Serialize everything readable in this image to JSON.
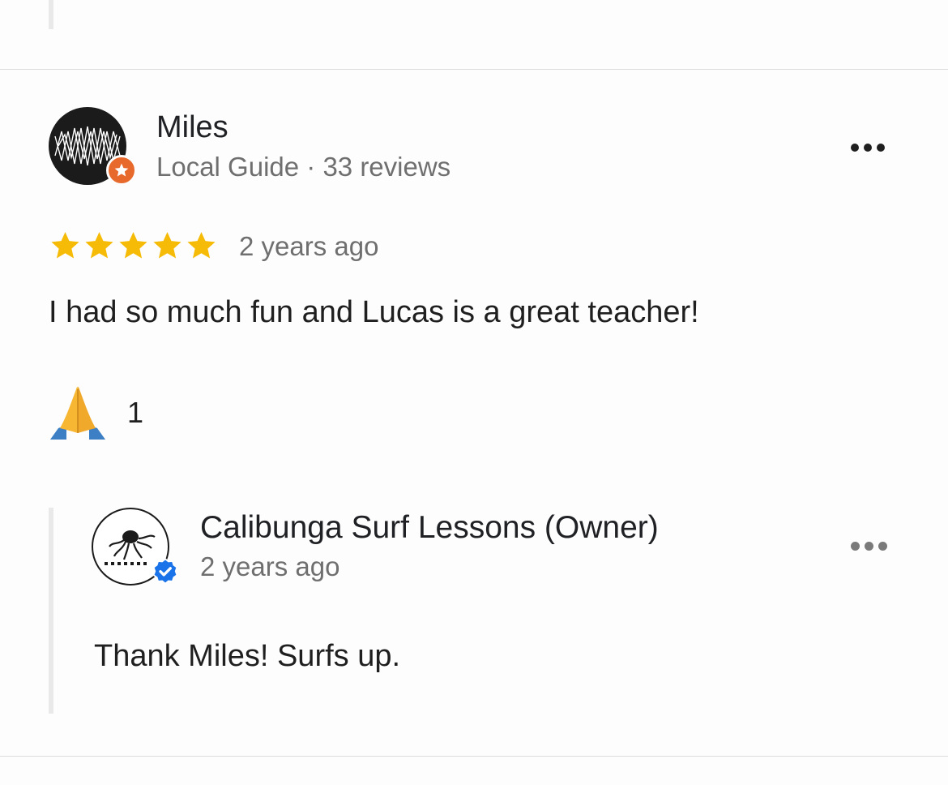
{
  "review": {
    "reviewer_name": "Miles",
    "reviewer_meta": "Local Guide · 33 reviews",
    "rating": 5,
    "rating_max": 5,
    "time": "2 years ago",
    "text": "I had so much fun and Lucas is a great teacher!",
    "reaction_emoji": "🙏",
    "reaction_count": "1"
  },
  "owner_reply": {
    "name": "Calibunga Surf Lessons (Owner)",
    "time": "2 years ago",
    "text": "Thank Miles! Surfs up.",
    "logo_text": "CALIBUNGA"
  },
  "icons": {
    "more": "more-horizontal-icon",
    "guide_badge": "star-icon",
    "verified": "verified-check-icon"
  },
  "colors": {
    "star": "#f6bb06",
    "guide_badge": "#e8692c",
    "verified": "#1a73e8",
    "divider": "#dcdcdc"
  }
}
